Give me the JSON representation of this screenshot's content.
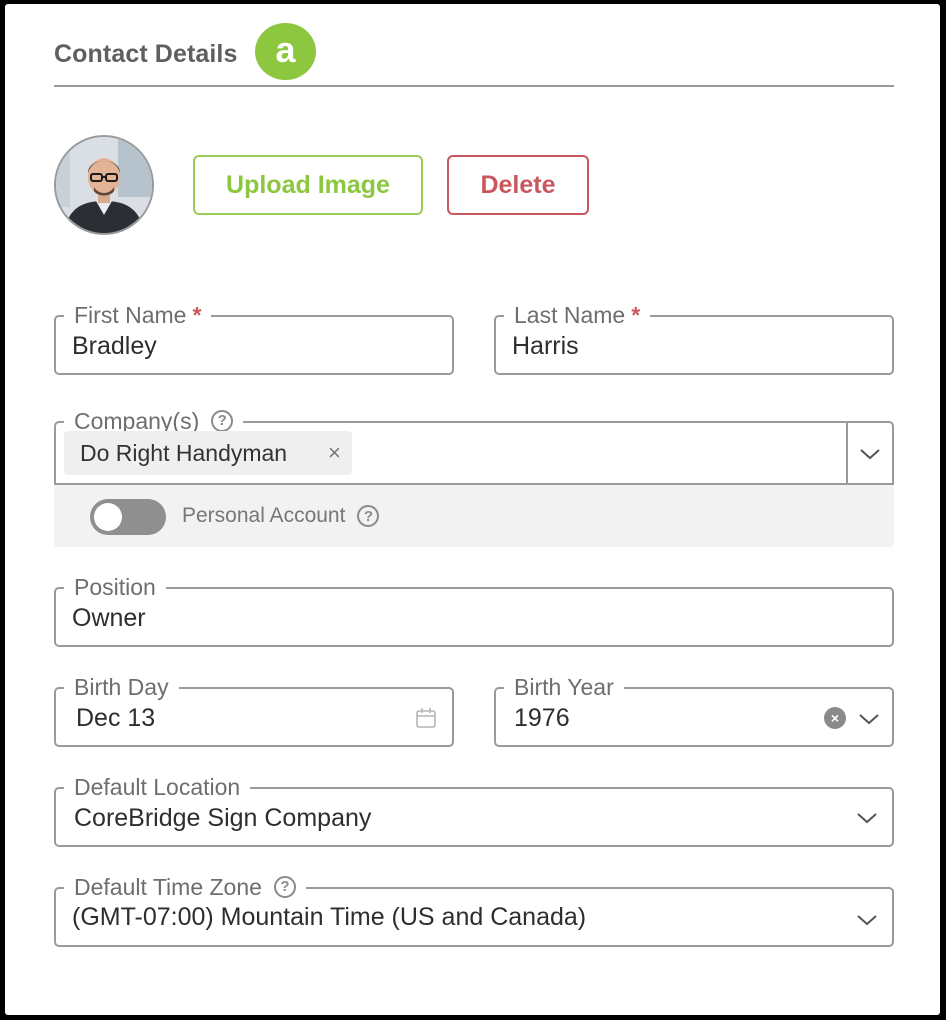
{
  "header": {
    "title": "Contact Details",
    "badge": "a"
  },
  "avatar": {
    "alt": "contact photo"
  },
  "actions": {
    "upload_label": "Upload Image",
    "delete_label": "Delete"
  },
  "first_name": {
    "label": "First Name",
    "required": "*",
    "value": "Bradley"
  },
  "last_name": {
    "label": "Last Name",
    "required": "*",
    "value": "Harris"
  },
  "companies": {
    "label": "Company(s)",
    "help": "?",
    "chips": [
      "Do Right Handyman"
    ],
    "remove": "×"
  },
  "personal_account": {
    "label": "Personal Account",
    "help": "?",
    "enabled": false
  },
  "position": {
    "label": "Position",
    "value": "Owner"
  },
  "birth_day": {
    "label": "Birth Day",
    "value": "Dec 13"
  },
  "birth_year": {
    "label": "Birth Year",
    "value": "1976",
    "clear": "×"
  },
  "default_location": {
    "label": "Default Location",
    "value": "CoreBridge Sign Company"
  },
  "default_time_zone": {
    "label": "Default Time Zone",
    "help": "?",
    "value": "(GMT-07:00) Mountain Time (US and Canada)"
  },
  "colors": {
    "accent_green": "#8dc63f",
    "danger_red": "#c9585e",
    "border_gray": "#9a9a9a"
  },
  "icons": [
    "calendar-icon",
    "chevron-down-icon",
    "clear-icon",
    "help-icon",
    "remove-chip-icon"
  ]
}
